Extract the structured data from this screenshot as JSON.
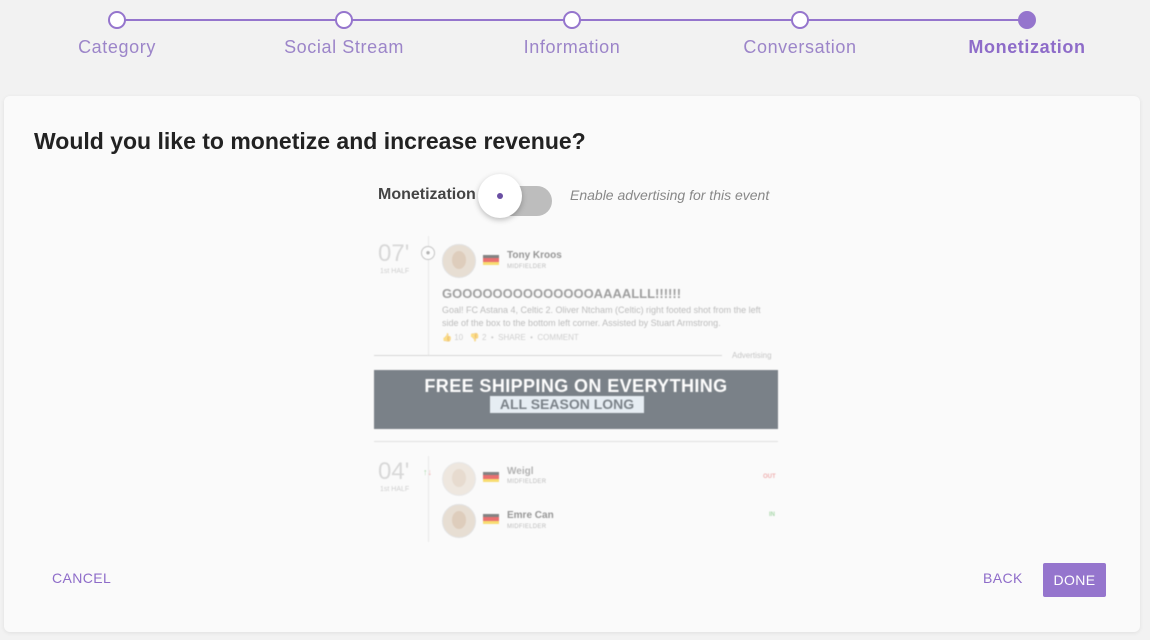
{
  "stepper": {
    "steps": [
      {
        "label": "Category"
      },
      {
        "label": "Social Stream"
      },
      {
        "label": "Information"
      },
      {
        "label": "Conversation"
      },
      {
        "label": "Monetization"
      }
    ],
    "active_index": 4
  },
  "main": {
    "question": "Would you like to monetize and increase revenue?",
    "monetization": {
      "label": "Monetization",
      "enabled": false,
      "hint": "Enable advertising for this event"
    }
  },
  "preview": {
    "event1": {
      "minute": "07'",
      "half": "1st HALF",
      "player_name": "Tony Kroos",
      "player_position": "MIDFIELDER",
      "title": "GOOOOOOOOOOOOOOAAAALLL!!!!!!",
      "text": "Goal! FC Astana 4, Celtic 2. Oliver Ntcham (Celtic) right footed shot from the left side of the box to the bottom left corner. Assisted by Stuart Armstrong.",
      "likes": "10",
      "dislikes": "2",
      "share": "SHARE",
      "comment": "COMMENT"
    },
    "advertising_label": "Advertising",
    "banner": {
      "line1": "FREE SHIPPING ON EVERYTHING",
      "line2": "ALL SEASON LONG"
    },
    "event2": {
      "minute": "04'",
      "half": "1st HALF",
      "player_out_name": "Weigl",
      "player_out_position": "MIDFIELDER",
      "out_tag": "OUT",
      "player_in_name": "Emre Can",
      "player_in_position": "MIDFIELDER",
      "in_tag": "IN"
    }
  },
  "footer": {
    "cancel": "CANCEL",
    "back": "BACK",
    "done": "DONE"
  },
  "colors": {
    "accent": "#9575cd",
    "toggle_off": "#bdbdbd",
    "banner_bg": "#13202c",
    "out_tag": "#e57373",
    "in_tag": "#66bb6a"
  }
}
